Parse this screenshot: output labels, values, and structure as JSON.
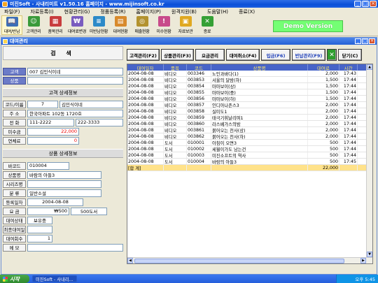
{
  "window": {
    "title": "미진Soft - 사내리미트 v1.50.16 홈페이지 - www.mijinsoft.co.kr",
    "inner_title": "대여관리",
    "demo_label": "Demo Version"
  },
  "menu": [
    "파일(F)",
    "자료등록(I)",
    "현황관리(G)",
    "정품등록(R)",
    "홈페이지(P)",
    "원격지원(B)",
    "도움말(H)",
    "종료(X)"
  ],
  "toolbar": [
    {
      "label": "대여/반납",
      "icon": "book-icon",
      "color": "#3d6fb6"
    },
    {
      "label": "고객관리",
      "icon": "person-icon",
      "color": "#3a9a3a"
    },
    {
      "label": "품목관리",
      "icon": "box-icon",
      "color": "#c83d3d"
    },
    {
      "label": "대여료변경",
      "icon": "money-icon",
      "color": "#7a5cbf"
    },
    {
      "label": "미반납현황",
      "icon": "list-icon",
      "color": "#2c8ac8"
    },
    {
      "label": "대여현황",
      "icon": "chart-icon",
      "color": "#d88a2c"
    },
    {
      "label": "매출현황",
      "icon": "coin-icon",
      "color": "#b3922e"
    },
    {
      "label": "미수현황",
      "icon": "alert-icon",
      "color": "#c84a8a"
    },
    {
      "label": "자료보관",
      "icon": "folder-icon",
      "color": "#e0a820"
    },
    {
      "label": "종료",
      "icon": "exit-icon",
      "color": "#35a035"
    }
  ],
  "search": {
    "heading": "검 색",
    "customer_label": "고객",
    "customer_value": "007 김민식이네",
    "product_label": "상품",
    "product_value": ""
  },
  "customer_detail": {
    "heading": "고객 상세정보",
    "code_label": "코드/이름",
    "code_value": "7",
    "name_value": "김민식이네",
    "address_label": "주 소",
    "address_value": "한국아파트 102동 1720호",
    "phone_label": "전 화",
    "phone1": "111-2222",
    "phone2": "222-3333",
    "receivable_label": "미수금",
    "receivable_value": "22,000",
    "overdue_label": "연체료",
    "overdue_value": "0"
  },
  "product_detail": {
    "heading": "상품 상세정보",
    "barcode_label": "바코드",
    "barcode_value": "010004",
    "name_label": "상품명",
    "name_value": "바람의 아들3",
    "series_label": "시리즈명",
    "series_value": "",
    "category_label": "분 류",
    "category_value": "일반소설",
    "reg_date_label": "등록일자",
    "reg_date_value": "2004-08-08",
    "fee_label": "요 금",
    "fee1": "₩500",
    "fee2": "500도서",
    "status_label": "대여상태",
    "status_value": "보유중",
    "last_customer_label": "최종대여일",
    "last_customer_value": "",
    "count_label": "대여회수",
    "count_value": "1",
    "memo_label": "메 모",
    "memo_value": ""
  },
  "action_buttons": [
    "고객관리(F2)",
    "상품관리(F3)",
    "요금관리",
    "대여취소(F4)",
    "입금(F6)",
    "반납관리(F9)",
    "닫기(C)"
  ],
  "table": {
    "headers": [
      "대여일자",
      "품목",
      "코드",
      "상품명",
      "대여료",
      "시간"
    ],
    "rows": [
      [
        "2004-08-08",
        "비디오",
        "003346",
        "노인과바다(1)",
        "2,000",
        "17:43"
      ],
      [
        "2004-08-08",
        "비디오",
        "003853",
        "서울의 달밤(하)",
        "1,500",
        "17:44"
      ],
      [
        "2004-08-08",
        "비디오",
        "003854",
        "마마보이(상)",
        "1,500",
        "17:44"
      ],
      [
        "2004-08-08",
        "비디오",
        "003855",
        "마마보이(중)",
        "1,500",
        "17:44"
      ],
      [
        "2004-08-08",
        "비디오",
        "003856",
        "마마보이(하)",
        "1,500",
        "17:44"
      ],
      [
        "2004-08-08",
        "비디오",
        "003857",
        "인디아나존스3",
        "2,000",
        "17:44"
      ],
      [
        "2004-08-08",
        "비디오",
        "003858",
        "실미도1",
        "2,000",
        "17:44"
      ],
      [
        "2004-08-08",
        "비디오",
        "003859",
        "태극기휘날리며1",
        "2,000",
        "17:44"
      ],
      [
        "2004-08-08",
        "비디오",
        "003860",
        "라스베가스의밤",
        "2,000",
        "17:44"
      ],
      [
        "2004-08-08",
        "비디오",
        "003861",
        "붉어오는 천사(상)",
        "2,000",
        "17:44"
      ],
      [
        "2004-08-08",
        "비디오",
        "003862",
        "붉어오는 천사(하)",
        "2,000",
        "17:44"
      ],
      [
        "2004-08-08",
        "도서",
        "010001",
        "아침이 오면3",
        "500",
        "17:44"
      ],
      [
        "2004-08-08",
        "도서",
        "010002",
        "세월이가도 남는건",
        "500",
        "17:44"
      ],
      [
        "2004-08-08",
        "도서",
        "010003",
        "미진소프트의 역사",
        "500",
        "17:44"
      ],
      [
        "2004-08-08",
        "도서",
        "010004",
        "바람의 아들3",
        "500",
        "17:45"
      ]
    ],
    "total_label": "[합 계]",
    "total_value": "22,000"
  },
  "taskbar": {
    "start": "시작",
    "tasks": [
      "미진Soft - 사내리...",
      "",
      "",
      ""
    ],
    "clock": "오후 5:45"
  }
}
